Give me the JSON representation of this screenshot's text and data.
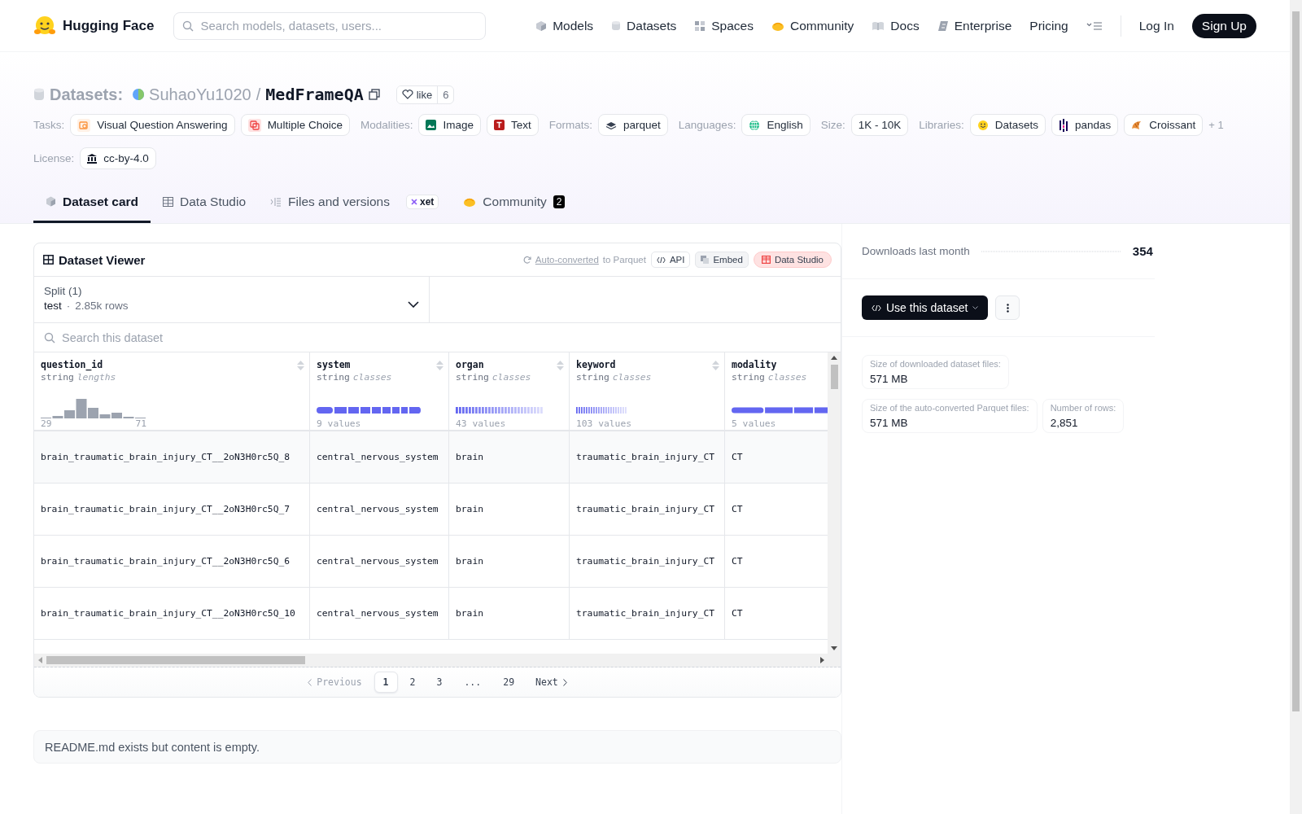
{
  "header": {
    "brand": "Hugging Face",
    "search": {
      "placeholder": "Search models, datasets, users..."
    },
    "nav": [
      {
        "label": "Models"
      },
      {
        "label": "Datasets"
      },
      {
        "label": "Spaces"
      },
      {
        "label": "Community"
      },
      {
        "label": "Docs"
      },
      {
        "label": "Enterprise"
      },
      {
        "label": "Pricing"
      }
    ],
    "login": "Log In",
    "signup": "Sign Up"
  },
  "repo": {
    "type_label": "Datasets:",
    "owner": "SuhaoYu1020",
    "separator": "/",
    "name": "MedFrameQA",
    "like_label": "like",
    "like_count": "6",
    "tag_groups": [
      {
        "label": "Tasks:",
        "items": [
          "Visual Question Answering",
          "Multiple Choice"
        ]
      },
      {
        "label": "Modalities:",
        "items": [
          "Image",
          "Text"
        ]
      },
      {
        "label": "Formats:",
        "items": [
          "parquet"
        ]
      },
      {
        "label": "Languages:",
        "items": [
          "English"
        ]
      },
      {
        "label": "Size:",
        "items": [
          "1K - 10K"
        ]
      },
      {
        "label": "Libraries:",
        "items": [
          "Datasets",
          "pandas",
          "Croissant"
        ],
        "more": "+ 1"
      },
      {
        "label": "License:",
        "items": [
          "cc-by-4.0"
        ]
      }
    ],
    "tabs": [
      {
        "label": "Dataset card",
        "selected": true
      },
      {
        "label": "Data Studio",
        "selected": false
      },
      {
        "label": "Files and versions",
        "selected": false,
        "badge": "xet"
      },
      {
        "label": "Community",
        "selected": false,
        "count": "2"
      }
    ]
  },
  "viewer": {
    "title": "Dataset Viewer",
    "converted_link": "Auto-converted",
    "converted_text": "to Parquet",
    "buttons": [
      "API",
      "Embed",
      "Data Studio"
    ],
    "split": {
      "label": "Split (1)",
      "value": "test",
      "separator": "·",
      "rows": "2.85k rows"
    },
    "search": {
      "placeholder": "Search this dataset"
    },
    "columns": [
      {
        "name": "question_id",
        "type": "string",
        "stat": "lengths",
        "kind": "histogram",
        "min": "29",
        "max": "71"
      },
      {
        "name": "system",
        "type": "string",
        "stat": "classes",
        "kind": "classes",
        "footer": "9 values"
      },
      {
        "name": "organ",
        "type": "string",
        "stat": "classes",
        "kind": "classes",
        "footer": "43 values"
      },
      {
        "name": "keyword",
        "type": "string",
        "stat": "classes",
        "kind": "classes",
        "footer": "103 values"
      },
      {
        "name": "modality",
        "type": "string",
        "stat": "classes",
        "kind": "classes",
        "footer": "5 values"
      }
    ],
    "rows": [
      [
        "brain_traumatic_brain_injury_CT__2oN3H0rc5Q_8",
        "central_nervous_system",
        "brain",
        "traumatic_brain_injury_CT",
        "CT"
      ],
      [
        "brain_traumatic_brain_injury_CT__2oN3H0rc5Q_7",
        "central_nervous_system",
        "brain",
        "traumatic_brain_injury_CT",
        "CT"
      ],
      [
        "brain_traumatic_brain_injury_CT__2oN3H0rc5Q_6",
        "central_nervous_system",
        "brain",
        "traumatic_brain_injury_CT",
        "CT"
      ],
      [
        "brain_traumatic_brain_injury_CT__2oN3H0rc5Q_10",
        "central_nervous_system",
        "brain",
        "traumatic_brain_injury_CT",
        "CT"
      ]
    ],
    "pagination": {
      "previous": {
        "label": "Previous",
        "disabled": true
      },
      "pages": [
        {
          "kind": "page",
          "label": "1",
          "selected": true
        },
        {
          "kind": "page",
          "label": "2",
          "selected": false
        },
        {
          "kind": "page",
          "label": "3",
          "selected": false
        },
        {
          "kind": "ellipsis",
          "label": "..."
        },
        {
          "kind": "page",
          "label": "29",
          "selected": false
        }
      ],
      "next": {
        "label": "Next",
        "disabled": false
      }
    }
  },
  "sidebar": {
    "downloads_label": "Downloads last month",
    "downloads": "354",
    "use_button": "Use this dataset",
    "stats": [
      {
        "label": "Size of downloaded dataset files:",
        "value": "571 MB"
      },
      {
        "label": "Size of the auto-converted Parquet files:",
        "value": "571 MB"
      },
      {
        "label": "Number of rows:",
        "value": "2,851"
      }
    ]
  },
  "readme": "README.md exists but content is empty."
}
